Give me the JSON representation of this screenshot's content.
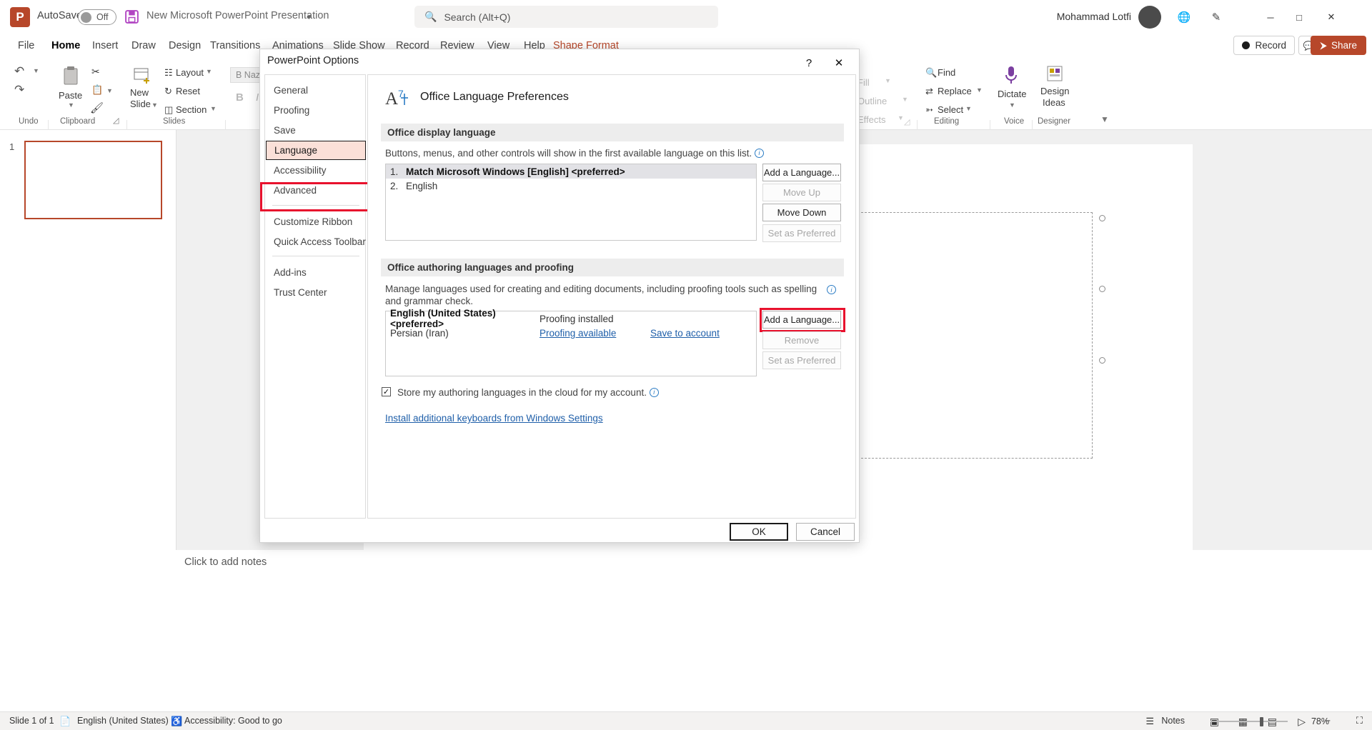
{
  "titlebar": {
    "autosave_label": "AutoSave",
    "autosave_state": "Off",
    "document_title": "New Microsoft PowerPoint Presentation",
    "search_placeholder": "Search (Alt+Q)",
    "user_name": "Mohammad Lotfi",
    "minimize": "─",
    "maximize": "□",
    "close": "✕"
  },
  "ribbon": {
    "tabs": [
      {
        "label": "File"
      },
      {
        "label": "Home"
      },
      {
        "label": "Insert"
      },
      {
        "label": "Draw"
      },
      {
        "label": "Design"
      },
      {
        "label": "Transitions"
      },
      {
        "label": "Animations"
      },
      {
        "label": "Slide Show"
      },
      {
        "label": "Record"
      },
      {
        "label": "Review"
      },
      {
        "label": "View"
      },
      {
        "label": "Help"
      },
      {
        "label": "Shape Format"
      }
    ],
    "record_button": "Record",
    "share_button": "Share",
    "groups": [
      {
        "label": "Undo"
      },
      {
        "label": "Clipboard"
      },
      {
        "label": "Slides"
      },
      {
        "label": "Editing"
      },
      {
        "label": "Voice"
      },
      {
        "label": "Designer"
      }
    ],
    "paste_label": "Paste",
    "new_slide_label": "New\nSlide",
    "layout_label": "Layout",
    "reset_label": "Reset",
    "section_label": "Section",
    "font_name": "B Naza",
    "bold_label": "B",
    "italic_label": "I",
    "fill_label": "Fill",
    "outline_label": "Outline",
    "effects_label": "Effects",
    "find_label": "Find",
    "replace_label": "Replace",
    "select_label": "Select",
    "dictate_label": "Dictate",
    "design_ideas_label": "Design\nIdeas"
  },
  "slidepane": {
    "slide_number": "1"
  },
  "notes": {
    "placeholder": "Click to add notes"
  },
  "statusbar": {
    "slide_count": "Slide 1 of 1",
    "language": "English (United States)",
    "accessibility": "Accessibility: Good to go",
    "notes_button": "Notes",
    "zoom_level": "78%",
    "zoom_out": "−",
    "zoom_in": "+"
  },
  "dialog": {
    "title": "PowerPoint Options",
    "help_icon": "?",
    "close_icon": "✕",
    "nav_items": [
      {
        "label": "General",
        "selected": false
      },
      {
        "label": "Proofing",
        "selected": false
      },
      {
        "label": "Save",
        "selected": false
      },
      {
        "label": "Language",
        "selected": true
      },
      {
        "label": "Accessibility",
        "selected": false
      },
      {
        "label": "Advanced",
        "selected": false
      },
      {
        "label": "Customize Ribbon",
        "selected": false
      },
      {
        "label": "Quick Access Toolbar",
        "selected": false
      },
      {
        "label": "Add-ins",
        "selected": false
      },
      {
        "label": "Trust Center",
        "selected": false
      }
    ],
    "page_title": "Office Language Preferences",
    "display_section": {
      "heading": "Office display language",
      "description": "Buttons, menus, and other controls will show in the first available language on this list.",
      "rows": [
        {
          "num": "1.",
          "label": "Match Microsoft Windows [English] <preferred>",
          "bold": true,
          "selected": true
        },
        {
          "num": "2.",
          "label": "English",
          "bold": false,
          "selected": false
        }
      ],
      "buttons": [
        {
          "label": "Add a Language...",
          "disabled": false
        },
        {
          "label": "Move Up",
          "disabled": true
        },
        {
          "label": "Move Down",
          "disabled": false
        },
        {
          "label": "Set as Preferred",
          "disabled": true
        }
      ]
    },
    "authoring_section": {
      "heading": "Office authoring languages and proofing",
      "description": "Manage languages used for creating and editing documents, including proofing tools such as spelling and grammar check.",
      "rows": [
        {
          "language": "English (United States) <preferred>",
          "bold": true,
          "status": "Proofing installed",
          "status_link": false,
          "action": "",
          "action_link": false
        },
        {
          "language": "Persian (Iran)",
          "bold": false,
          "status": "Proofing available",
          "status_link": true,
          "action": "Save to account",
          "action_link": true
        }
      ],
      "buttons": [
        {
          "label": "Add a Language...",
          "disabled": false,
          "highlighted": true
        },
        {
          "label": "Remove",
          "disabled": true,
          "highlighted": false
        },
        {
          "label": "Set as Preferred",
          "disabled": true,
          "highlighted": false
        }
      ],
      "checkbox_label": "Store my authoring languages in the cloud for my account.",
      "checkbox_checked": true,
      "keyboards_link": "Install additional keyboards from Windows Settings"
    },
    "ok_button": "OK",
    "cancel_button": "Cancel"
  },
  "colors": {
    "accent_red": "#b7472a",
    "highlight_red": "#e8112d",
    "selection_pink": "#fbe0d8",
    "link_blue": "#1f5fa9"
  }
}
